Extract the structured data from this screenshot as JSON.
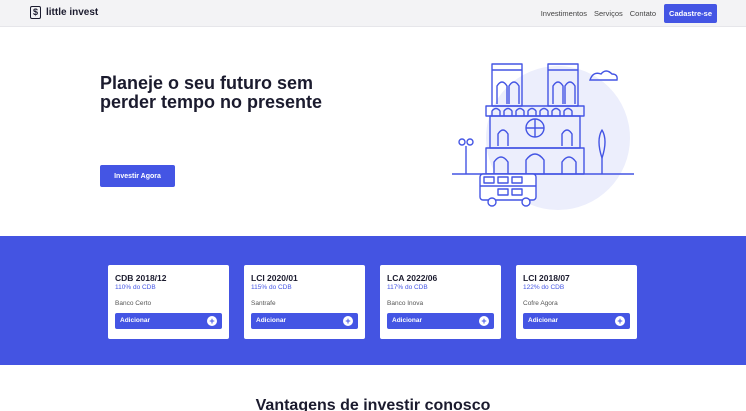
{
  "nav": {
    "brand_icon": "$",
    "brand": "little invest",
    "links": [
      "Investimentos",
      "Serviços",
      "Contato"
    ],
    "cta": "Cadastre-se"
  },
  "hero": {
    "title": "Planeje o seu futuro sem perder tempo no presente",
    "cta": "Investir Agora",
    "illustration": "cathedral-bus-icon"
  },
  "colors": {
    "accent": "#4455e4",
    "band": "#4454e2",
    "illustration_bg": "#eceefc"
  },
  "products": [
    {
      "name": "CDB 2018/12",
      "rate": "110% do CDB",
      "bank": "Banco Certo",
      "button": "Adicionar"
    },
    {
      "name": "LCI 2020/01",
      "rate": "115% do CDB",
      "bank": "Santrafe",
      "button": "Adicionar"
    },
    {
      "name": "LCA 2022/06",
      "rate": "117% do CDB",
      "bank": "Banco Inova",
      "button": "Adicionar"
    },
    {
      "name": "LCI 2018/07",
      "rate": "122% do CDB",
      "bank": "Cofre Agora",
      "button": "Adicionar"
    }
  ],
  "advantages": {
    "title": "Vantagens de investir conosco"
  }
}
